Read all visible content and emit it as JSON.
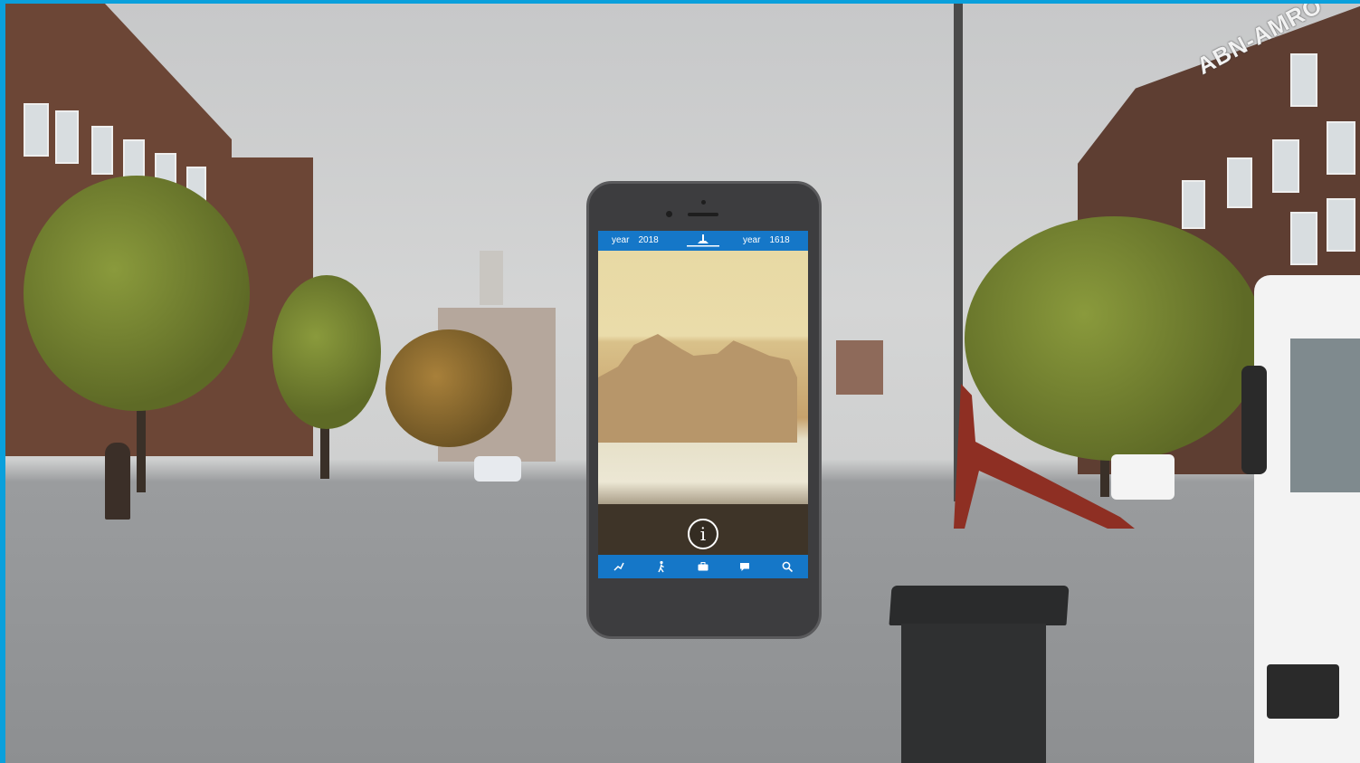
{
  "scene": {
    "signage": {
      "brand": "ABN-AMRO"
    }
  },
  "app": {
    "header": {
      "left_year_label": "year",
      "left_year_value": "2018",
      "right_year_label": "year",
      "right_year_value": "1618"
    },
    "info_glyph": "i",
    "tabs": [
      {
        "icon": "route-icon"
      },
      {
        "icon": "walking-person-icon"
      },
      {
        "icon": "briefcase-icon"
      },
      {
        "icon": "chat-bubble-icon"
      },
      {
        "icon": "search-icon"
      }
    ],
    "colors": {
      "accent": "#1577c8",
      "frame_border": "#0aa0dc"
    }
  }
}
